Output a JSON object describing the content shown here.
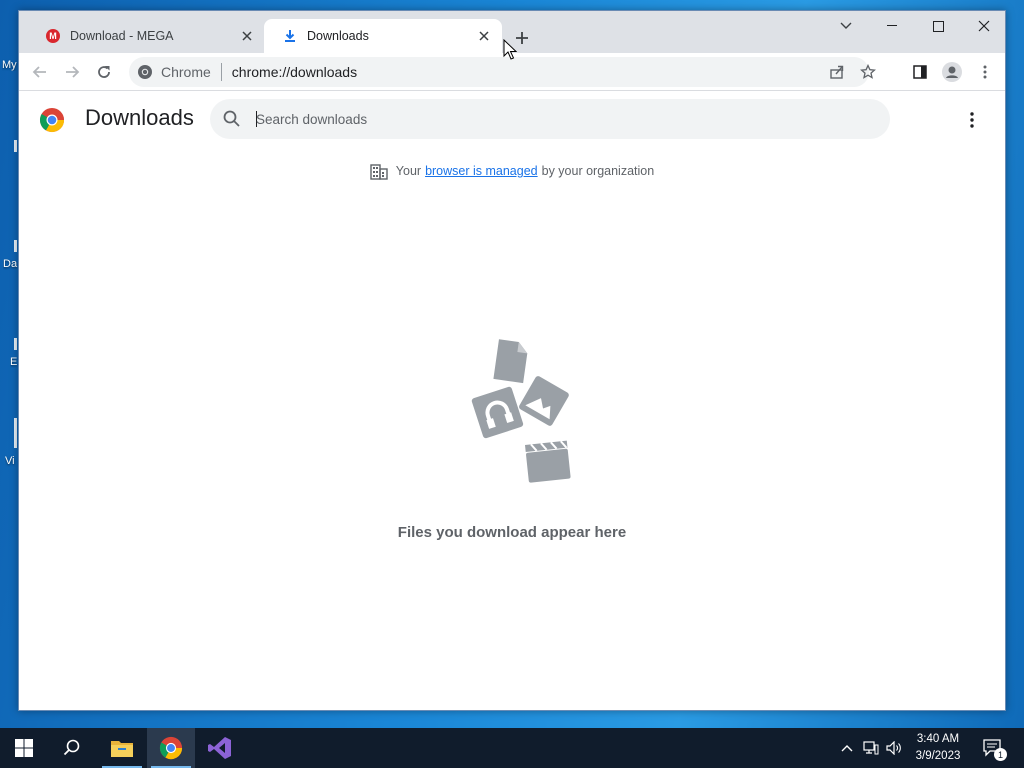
{
  "desktop": {
    "labels": [
      "My",
      "Da",
      "E",
      "Vi"
    ]
  },
  "tabs": [
    {
      "title": "Download - MEGA",
      "active": false,
      "icon": "mega-icon"
    },
    {
      "title": "Downloads",
      "active": true,
      "icon": "download-arrow-icon"
    }
  ],
  "omnibox": {
    "site_label": "Chrome",
    "url": "chrome://downloads"
  },
  "downloads_page": {
    "title": "Downloads",
    "search_placeholder": "Search downloads",
    "managed_prefix": "Your",
    "managed_link": "browser is managed",
    "managed_suffix": "by your organization",
    "empty_message": "Files you download appear here"
  },
  "taskbar": {
    "time": "3:40 AM",
    "date": "3/9/2023",
    "notification_count": "1",
    "pinned": [
      "start-icon",
      "search-icon",
      "file-explorer-icon",
      "chrome-icon",
      "visual-studio-icon"
    ]
  },
  "colors": {
    "tab_strip": "#dee1e6",
    "link": "#1a73e8",
    "taskbar": "#101c2c",
    "accent": "#76b9ed"
  }
}
